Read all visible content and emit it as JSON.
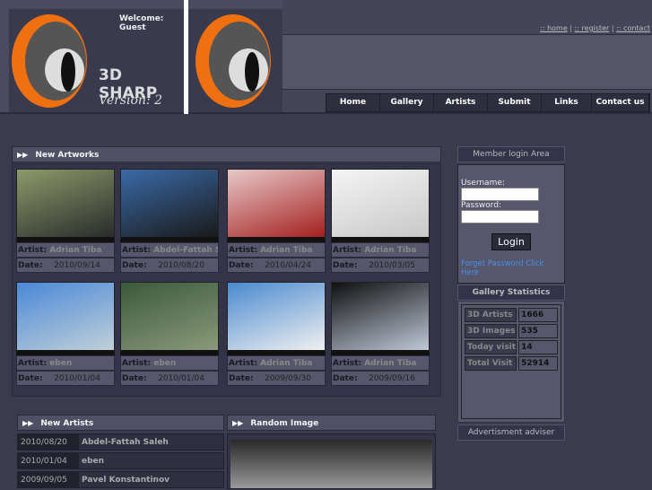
{
  "header": {
    "welcome": "Welcome: Guest",
    "logo_text": "3D SHARP",
    "version": "Version: 2",
    "links": [
      ":: home",
      ":: register",
      ":: contact"
    ]
  },
  "nav": [
    "Home",
    "Gallery",
    "Artists",
    "Submit",
    "Links",
    "Contact us"
  ],
  "new_artworks": {
    "title": "New Artworks",
    "artist_label": "Artist:",
    "date_label": "Date:",
    "items": [
      {
        "artist": "Adrian Tiba",
        "date": "2010/09/14",
        "c1": "#8c9a6a",
        "c2": "#2b2b2b"
      },
      {
        "artist": "Abdel-Fattah Saleh",
        "date": "2010/08/20",
        "c1": "#3a6aa8",
        "c2": "#1a1a1a"
      },
      {
        "artist": "Adrian Tiba",
        "date": "2010/04/24",
        "c1": "#e8c8c8",
        "c2": "#a42020"
      },
      {
        "artist": "Adrian Tiba",
        "date": "2010/03/05",
        "c1": "#f4f4f4",
        "c2": "#c8c8c8"
      },
      {
        "artist": "eben",
        "date": "2010/01/04",
        "c1": "#4a88d8",
        "c2": "#c0d0d8"
      },
      {
        "artist": "eben",
        "date": "2010/01/04",
        "c1": "#3a5a3a",
        "c2": "#8a9a7a"
      },
      {
        "artist": "Adrian Tiba",
        "date": "2009/09/30",
        "c1": "#4a8ad0",
        "c2": "#f0f0f0"
      },
      {
        "artist": "Adrian Tiba",
        "date": "2009/09/16",
        "c1": "#101010",
        "c2": "#c0c8d8"
      }
    ]
  },
  "login": {
    "title": "Member login Area",
    "username_label": "Username:",
    "password_label": "Password:",
    "button": "Login",
    "forgot": "Forget Password Click Here"
  },
  "stats": {
    "title": "Gallery Statistics",
    "rows": [
      {
        "label": "3D Artists",
        "value": "1666"
      },
      {
        "label": "3D Images",
        "value": "535"
      },
      {
        "label": "Today visit",
        "value": "14"
      },
      {
        "label": "Total Visit",
        "value": "52914"
      }
    ]
  },
  "ad": {
    "title": "Advertisment adviser"
  },
  "new_artists": {
    "title": "New Artists",
    "rows": [
      {
        "date": "2010/08/20",
        "name": "Abdel-Fattah Saleh"
      },
      {
        "date": "2010/01/04",
        "name": "eben"
      },
      {
        "date": "2009/09/05",
        "name": "Pavel Konstantinov"
      }
    ]
  },
  "random_image": {
    "title": "Random Image"
  }
}
